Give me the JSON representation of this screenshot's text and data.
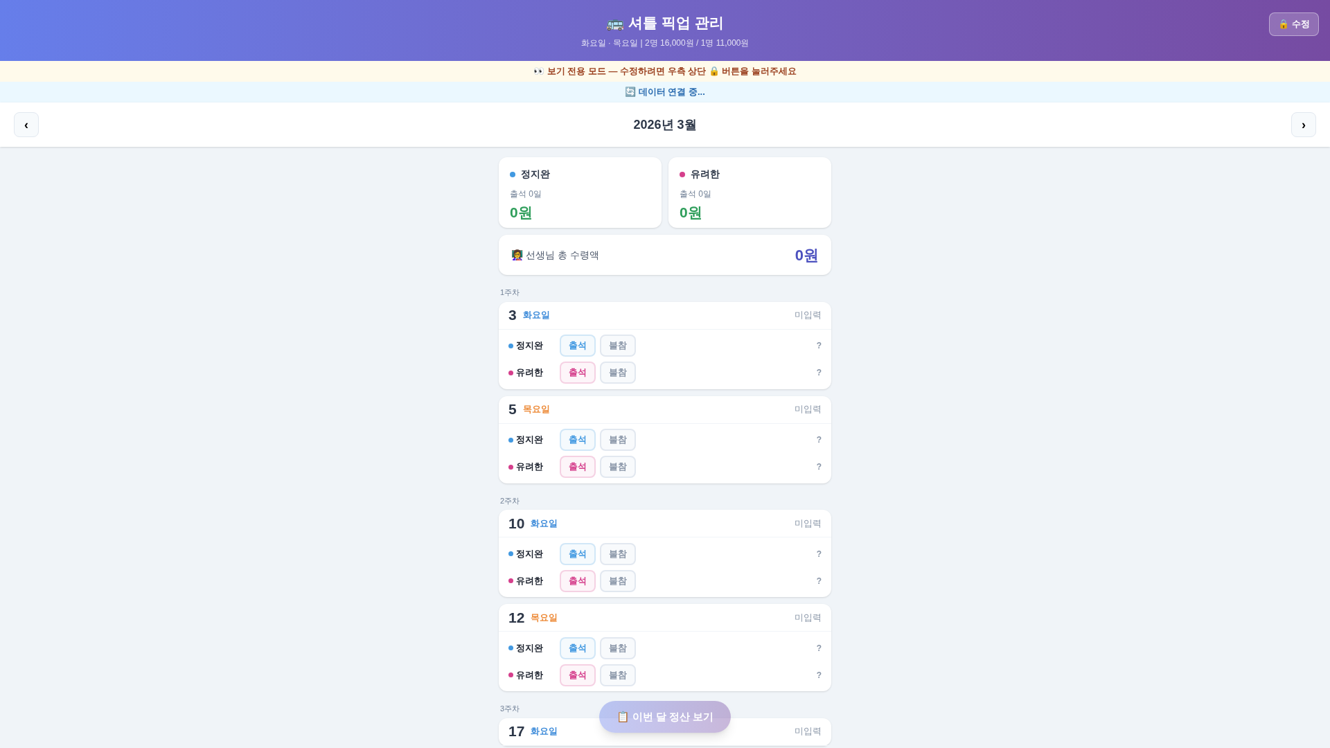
{
  "header": {
    "title": "🚌 셔틀 픽업 관리",
    "subtitle": "화요일 · 목요일 | 2명 16,000원 / 1명 11,000원",
    "edit_button": "🔒 수정"
  },
  "notices": [
    {
      "kind": "warning",
      "text": "👀 보기 전용 모드 — 수정하려면 우측 상단 🔒 버튼을 눌러주세요"
    },
    {
      "kind": "info",
      "text": "🔄 데이터 연결 중..."
    }
  ],
  "month_nav": {
    "prev": "‹",
    "label": "2026년 3월",
    "next": "›"
  },
  "students": [
    {
      "name": "정지완",
      "color": "#4299e1",
      "attendance": "출석 0일",
      "amount": "0원"
    },
    {
      "name": "유려한",
      "color": "#d53f8c",
      "attendance": "출석 0일",
      "amount": "0원"
    }
  ],
  "total": {
    "label": "👩‍🏫 선생님 총 수령액",
    "amount": "0원"
  },
  "weeks": [
    {
      "label": "1주차",
      "days": [
        {
          "date": "3",
          "weekday": "화요일",
          "color": "#3b8ad9",
          "status": "미입력",
          "rows": [
            {
              "name": "정지완",
              "color": "#4299e1",
              "options": [
                {
                  "label": "출석",
                  "kind": "present",
                  "selected": false
                },
                {
                  "label": "불참",
                  "kind": "absent",
                  "selected": false
                }
              ],
              "result": "?"
            },
            {
              "name": "유려한",
              "color": "#d53f8c",
              "options": [
                {
                  "label": "출석",
                  "kind": "present",
                  "selected": false
                },
                {
                  "label": "불참",
                  "kind": "absent",
                  "selected": false
                }
              ],
              "result": "?"
            }
          ]
        },
        {
          "date": "5",
          "weekday": "목요일",
          "color": "#ed8936",
          "status": "미입력",
          "rows": [
            {
              "name": "정지완",
              "color": "#4299e1",
              "options": [
                {
                  "label": "출석",
                  "kind": "present",
                  "selected": false
                },
                {
                  "label": "불참",
                  "kind": "absent",
                  "selected": false
                }
              ],
              "result": "?"
            },
            {
              "name": "유려한",
              "color": "#d53f8c",
              "options": [
                {
                  "label": "출석",
                  "kind": "present",
                  "selected": false
                },
                {
                  "label": "불참",
                  "kind": "absent",
                  "selected": false
                }
              ],
              "result": "?"
            }
          ]
        }
      ]
    },
    {
      "label": "2주차",
      "days": [
        {
          "date": "10",
          "weekday": "화요일",
          "color": "#3b8ad9",
          "status": "미입력",
          "rows": [
            {
              "name": "정지완",
              "color": "#4299e1",
              "options": [
                {
                  "label": "출석",
                  "kind": "present",
                  "selected": false
                },
                {
                  "label": "불참",
                  "kind": "absent",
                  "selected": false
                }
              ],
              "result": "?"
            },
            {
              "name": "유려한",
              "color": "#d53f8c",
              "options": [
                {
                  "label": "출석",
                  "kind": "present",
                  "selected": false
                },
                {
                  "label": "불참",
                  "kind": "absent",
                  "selected": false
                }
              ],
              "result": "?"
            }
          ]
        },
        {
          "date": "12",
          "weekday": "목요일",
          "color": "#ed8936",
          "status": "미입력",
          "rows": [
            {
              "name": "정지완",
              "color": "#4299e1",
              "options": [
                {
                  "label": "출석",
                  "kind": "present",
                  "selected": false
                },
                {
                  "label": "불참",
                  "kind": "absent",
                  "selected": false
                }
              ],
              "result": "?"
            },
            {
              "name": "유려한",
              "color": "#d53f8c",
              "options": [
                {
                  "label": "출석",
                  "kind": "present",
                  "selected": false
                },
                {
                  "label": "불참",
                  "kind": "absent",
                  "selected": false
                }
              ],
              "result": "?"
            }
          ]
        }
      ]
    },
    {
      "label": "3주차",
      "days": [
        {
          "date": "17",
          "weekday": "화요일",
          "color": "#3b8ad9",
          "status": "미입력"
        }
      ]
    }
  ],
  "summary_button": "📋 이번 달 정산 보기"
}
